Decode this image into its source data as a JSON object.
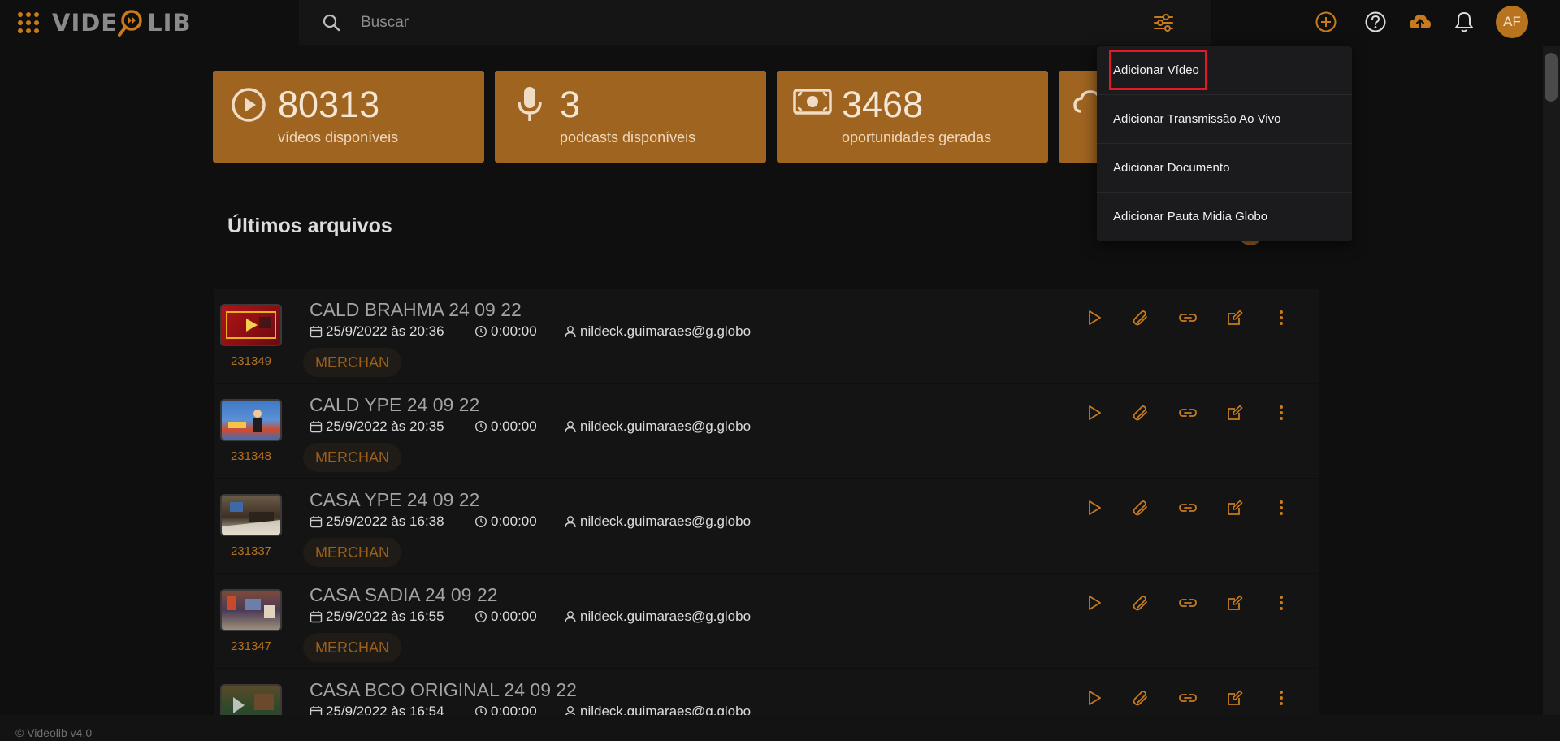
{
  "app": {
    "logo_left": "VIDE",
    "logo_right": "LIB",
    "version": "© Videolib v4.0"
  },
  "header": {
    "search_placeholder": "Buscar",
    "avatar_initials": "AF",
    "icons": [
      "apps-grid-icon",
      "search-icon",
      "filter-sliders-icon",
      "add-circle-icon",
      "help-circle-icon",
      "cloud-upload-icon",
      "bell-icon"
    ]
  },
  "stats": [
    {
      "number": "80313",
      "label": "vídeos disponíveis",
      "icon": "play-circle-icon"
    },
    {
      "number": "3",
      "label": "podcasts disponíveis",
      "icon": "microphone-icon"
    },
    {
      "number": "3468",
      "label": "oportunidades geradas",
      "icon": "money-bill-icon"
    },
    {
      "number": "",
      "label": "",
      "icon": "cloud-icon"
    }
  ],
  "section": {
    "title": "Últimos arquivos"
  },
  "files": [
    {
      "id": "231349",
      "title": "CALD BRAHMA 24 09 22",
      "date": "25/9/2022 às 20:36",
      "duration": "0:00:00",
      "user": "nildeck.guimaraes@g.globo",
      "tag": "MERCHAN"
    },
    {
      "id": "231348",
      "title": "CALD YPE 24 09 22",
      "date": "25/9/2022 às 20:35",
      "duration": "0:00:00",
      "user": "nildeck.guimaraes@g.globo",
      "tag": "MERCHAN"
    },
    {
      "id": "231337",
      "title": "CASA YPE 24 09 22",
      "date": "25/9/2022 às 16:38",
      "duration": "0:00:00",
      "user": "nildeck.guimaraes@g.globo",
      "tag": "MERCHAN"
    },
    {
      "id": "231347",
      "title": "CASA SADIA 24 09 22",
      "date": "25/9/2022 às 16:55",
      "duration": "0:00:00",
      "user": "nildeck.guimaraes@g.globo",
      "tag": "MERCHAN"
    },
    {
      "id": "",
      "title": "CASA BCO ORIGINAL 24 09 22",
      "date": "25/9/2022 às 16:54",
      "duration": "0:00:00",
      "user": "nildeck.guimaraes@g.globo",
      "tag": ""
    }
  ],
  "dropdown": {
    "items": [
      {
        "label": "Adicionar Vídeo",
        "highlighted": true
      },
      {
        "label": "Adicionar Transmissão Ao Vivo"
      },
      {
        "label": "Adicionar Documento"
      },
      {
        "label": "Adicionar Pauta Midia Globo"
      }
    ]
  },
  "colors": {
    "accent": "#c97a1d",
    "card": "#a06421",
    "background": "#0f0f10",
    "highlight_box": "#e21a26"
  }
}
